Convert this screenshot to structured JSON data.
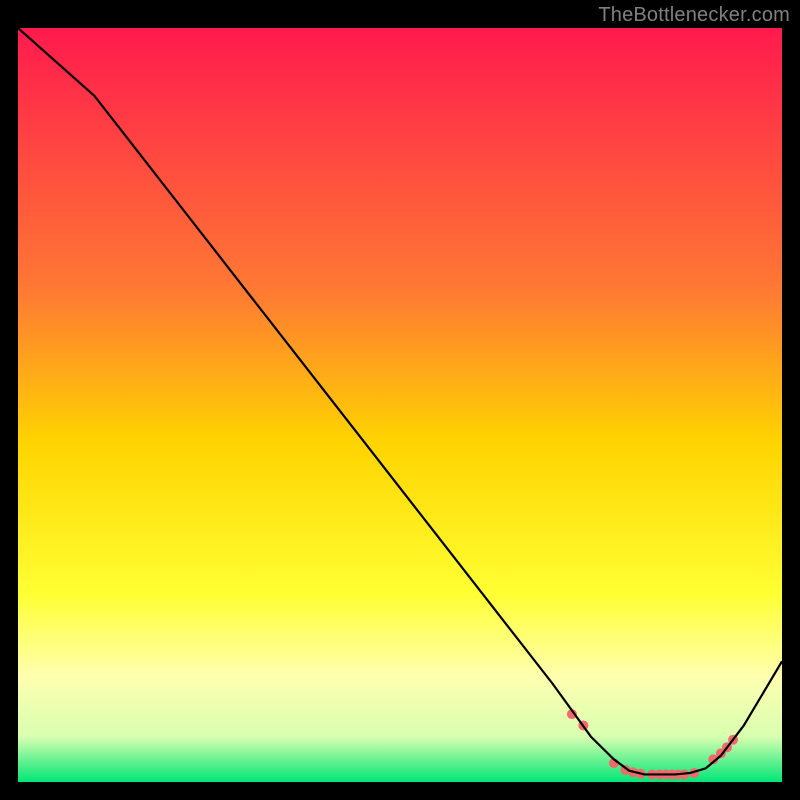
{
  "watermark": "TheBottleneсker.com",
  "chart_data": {
    "type": "line",
    "title": "",
    "xlabel": "",
    "ylabel": "",
    "xlim": [
      0,
      100
    ],
    "ylim": [
      0,
      100
    ],
    "grid": false,
    "background_gradient": [
      {
        "stop": 0.0,
        "color": "#ff1a4d"
      },
      {
        "stop": 0.35,
        "color": "#ff7a33"
      },
      {
        "stop": 0.55,
        "color": "#ffd400"
      },
      {
        "stop": 0.75,
        "color": "#ffff33"
      },
      {
        "stop": 0.86,
        "color": "#ffffb0"
      },
      {
        "stop": 0.94,
        "color": "#d8ffb0"
      },
      {
        "stop": 1.0,
        "color": "#00e676"
      }
    ],
    "series": [
      {
        "name": "curve",
        "color": "#000000",
        "x": [
          0,
          10,
          20,
          30,
          40,
          50,
          60,
          70,
          75,
          78,
          80,
          82,
          84,
          86,
          88,
          90,
          92,
          95,
          100
        ],
        "y": [
          100,
          91,
          78,
          65,
          52,
          39,
          26,
          13,
          6,
          3,
          1.5,
          1,
          1,
          1,
          1.2,
          1.8,
          3.5,
          7.5,
          16
        ]
      }
    ],
    "markers": {
      "name": "dots",
      "color": "#ef6b6b",
      "radius": 5,
      "x": [
        72.5,
        74,
        78,
        79.5,
        80.5,
        81.5,
        83,
        84,
        84.8,
        85.6,
        86.4,
        87.2,
        88.5,
        91,
        92,
        92.8,
        93.6
      ],
      "y": [
        9,
        7.5,
        2.5,
        1.6,
        1.3,
        1.1,
        1,
        1,
        1,
        1,
        1,
        1,
        1.2,
        3,
        3.8,
        4.6,
        5.6
      ]
    }
  }
}
